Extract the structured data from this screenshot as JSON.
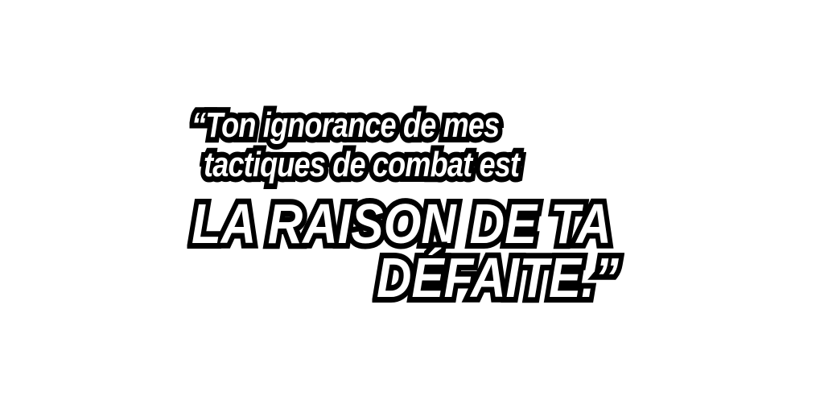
{
  "quote": {
    "line1": "“Ton ignorance de mes",
    "line2": "tactiques de combat est",
    "line3": "LA RAISON DE TA",
    "line4": "DÉFAITE.”"
  },
  "colors": {
    "background": "#ffffff",
    "text_fill": "#ffffff",
    "text_outline": "#000000"
  }
}
